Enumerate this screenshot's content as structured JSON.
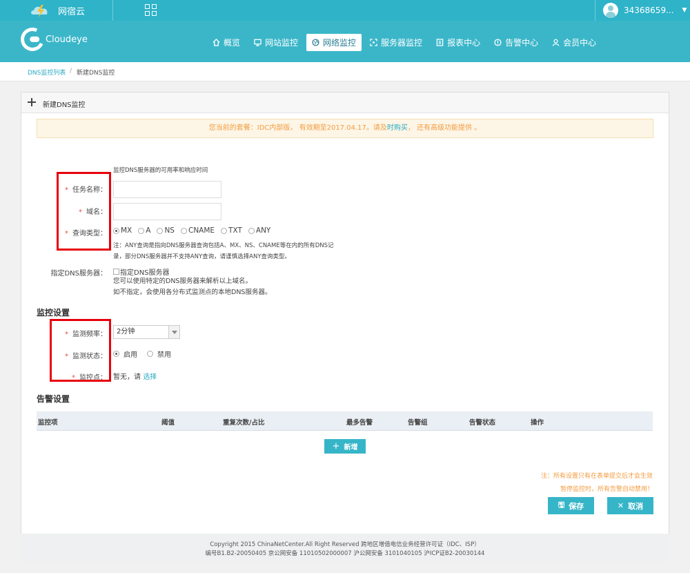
{
  "topbar": {
    "logo_text": "网宿云",
    "username": "34368659..."
  },
  "navbar": {
    "brand": "Cloudeye",
    "items": [
      {
        "label": "概览",
        "icon": "home-icon"
      },
      {
        "label": "网站监控",
        "icon": "monitor-icon"
      },
      {
        "label": "网络监控",
        "icon": "globe-icon",
        "active": true
      },
      {
        "label": "服务器监控",
        "icon": "server-icon"
      },
      {
        "label": "报表中心",
        "icon": "report-icon"
      },
      {
        "label": "告警中心",
        "icon": "alert-icon"
      },
      {
        "label": "会员中心",
        "icon": "user-icon"
      }
    ]
  },
  "breadcrumb": {
    "parent": "DNS监控列表",
    "separator": "/",
    "current": "新建DNS监控"
  },
  "panel": {
    "title": "新建DNS监控"
  },
  "notice": {
    "before": "您当前的套餐：IDC内部版， 有效期至2017.04.17。请及",
    "link": "时购买",
    "after": "， 还有高级功能提供 。"
  },
  "form": {
    "intro": "监控DNS服务器的可用率和响应时间",
    "task_name_label": "任务名称：",
    "domain_label": "域名：",
    "query_type_label": "查询类型：",
    "query_types": [
      "MX",
      "A",
      "NS",
      "CNAME",
      "TXT",
      "ANY"
    ],
    "query_selected": "MX",
    "query_note_1": "注：ANY查询是指向DNS服务器查询包括A、MX、NS、CNAME等在内的所有DNS记",
    "query_note_2": "录，部分DNS服务器并不支持ANY查询，请谨慎选择ANY查询类型。",
    "dns_server_label": "指定DNS服务器：",
    "dns_server_checkbox": "指定DNS服务器",
    "dns_server_note_1": "您可以使用特定的DNS服务器来解析以上域名。",
    "dns_server_note_2": "如不指定，会使用各分布式监测点的本地DNS服务器。"
  },
  "monitor": {
    "section_title": "监控设置",
    "frequency_label": "监测频率：",
    "frequency_value": "2分钟",
    "status_label": "监测状态：",
    "status_on": "启用",
    "status_off": "禁用",
    "points_label": "监控点：",
    "points_text": "暂无，请",
    "points_link": "选择"
  },
  "alert": {
    "section_title": "告警设置",
    "columns": [
      "监控项",
      "阈值",
      "重复次数/占比",
      "最多告警",
      "告警组",
      "告警状态",
      "操作"
    ],
    "add_label": "新增"
  },
  "footer_notes": {
    "note_1": "注：所有设置只有在表单提交后才会生效",
    "note_2": "暂停监控时，所有告警自动禁用！"
  },
  "actions": {
    "save_label": "保存",
    "cancel_label": "取消"
  },
  "footer": {
    "line_1": "Copyright 2015 ChinaNetCenter.All Right Reserved 跨地区增值电信业务经营许可证（IDC、ISP）",
    "line_2": "编号B1.B2-20050405 京公网安备 11010502000007 沪公网安备 3101040105 沪ICP证B2-20030144"
  },
  "colors": {
    "brand": "#3bb6c9",
    "accent": "#2aa9c2",
    "warning": "#f39c40",
    "required": "#e74c3c",
    "highlight": "#e8000b"
  }
}
